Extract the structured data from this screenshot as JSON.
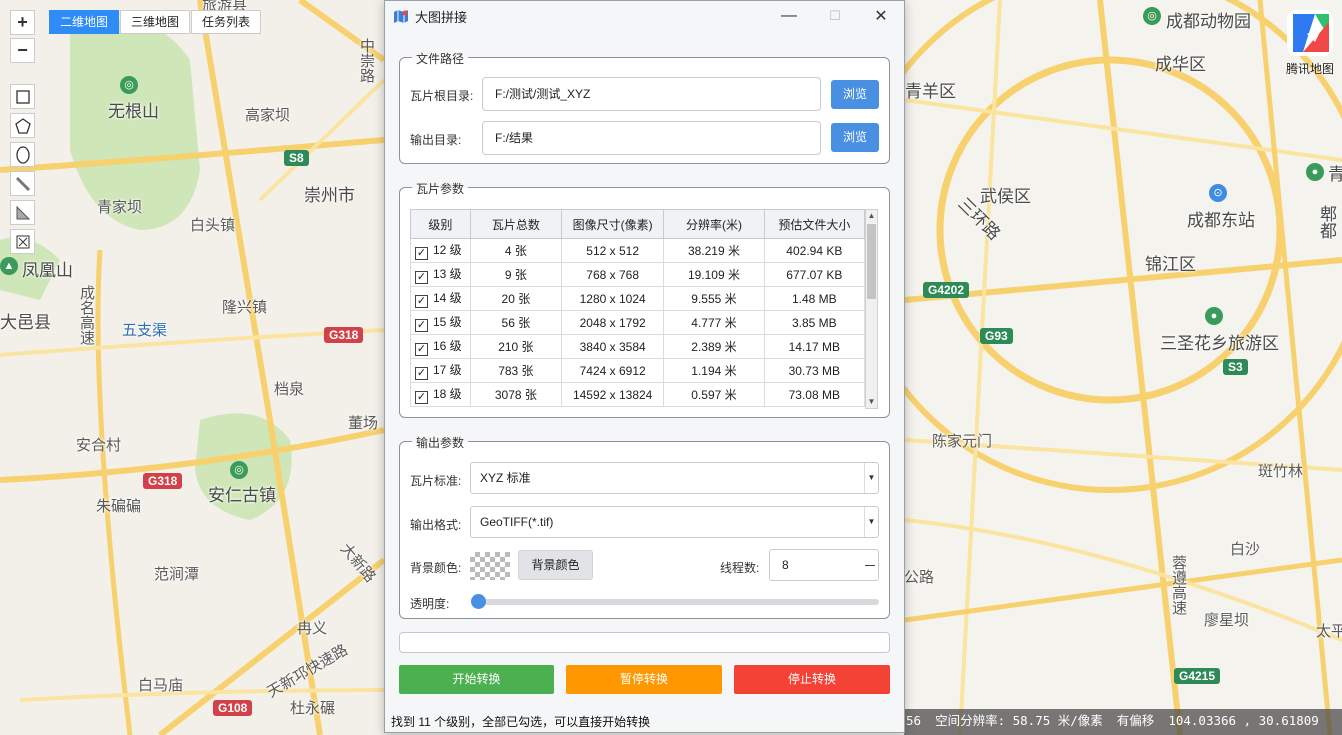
{
  "map": {
    "tabs": [
      {
        "label": "二维地图",
        "active": true
      },
      {
        "label": "三维地图",
        "active": false
      },
      {
        "label": "任务列表",
        "active": false
      }
    ],
    "zoom_in": "+",
    "zoom_out": "−",
    "brand": "腾讯地图",
    "labels": {
      "l1": "成都动物园",
      "l2": "成华区",
      "l3": "青羊区",
      "l4": "武侯区",
      "l5": "成都东站",
      "l6": "锦江区",
      "l7": "三圣花乡旅游区",
      "l8": "陈家元门",
      "l9": "斑竹林",
      "l10": "白沙",
      "l11": "廖星坝",
      "l12": "太平",
      "l13": "三环路",
      "l14": "蓉遵高速",
      "l15": "无根山",
      "l16": "高家坝",
      "l17": "崇州市",
      "l18": "青家坝",
      "l19": "白头镇",
      "l20": "凤凰山",
      "l21": "大邑县",
      "l22": "五支渠",
      "l23": "隆兴镇",
      "l24": "成名高速",
      "l25": "安合村",
      "l26": "安仁古镇",
      "l27": "朱碥碥",
      "l28": "范涧潭",
      "l29": "大新路",
      "l30": "冉义",
      "l31": "天新邛快速路",
      "l32": "白马庙",
      "l33": "杜永碾",
      "l34": "档泉",
      "l35": "董场",
      "l36": "旅游县",
      "l37": "公路",
      "l38": "郫都",
      "l39": "中崇路",
      "l40": "青"
    },
    "shields": {
      "s8": "S8",
      "g318a": "G318",
      "g318b": "G318",
      "g108": "G108",
      "g4202": "G4202",
      "g93": "G93",
      "s3": "S3",
      "g4215": "G4215"
    },
    "status": {
      "prefix": "56",
      "resolution": "空间分辨率: 58.75 米/像素",
      "offset": "有偏移",
      "coords": "104.03366 , 30.61809"
    }
  },
  "dialog": {
    "title": "大图拼接",
    "window_controls": {
      "minimize": "—",
      "maximize": "☐",
      "close": "✕"
    },
    "path_group": {
      "title": "文件路径",
      "tile_root_label": "瓦片根目录:",
      "tile_root_value": "F:/测试/测试_XYZ",
      "browse1": "浏览",
      "output_label": "输出目录:",
      "output_value": "F:/结果",
      "browse2": "浏览"
    },
    "tile_group": {
      "title": "瓦片参数",
      "headers": [
        "级别",
        "瓦片总数",
        "图像尺寸(像素)",
        "分辨率(米)",
        "预估文件大小"
      ],
      "rows": [
        {
          "level": "12 级",
          "count": "4 张",
          "size": "512 x 512",
          "res": "38.219 米",
          "est": "402.94 KB",
          "checked": true
        },
        {
          "level": "13 级",
          "count": "9 张",
          "size": "768 x 768",
          "res": "19.109 米",
          "est": "677.07 KB",
          "checked": true
        },
        {
          "level": "14 级",
          "count": "20 张",
          "size": "1280 x 1024",
          "res": "9.555 米",
          "est": "1.48 MB",
          "checked": true
        },
        {
          "level": "15 级",
          "count": "56 张",
          "size": "2048 x 1792",
          "res": "4.777 米",
          "est": "3.85 MB",
          "checked": true
        },
        {
          "level": "16 级",
          "count": "210 张",
          "size": "3840 x 3584",
          "res": "2.389 米",
          "est": "14.17 MB",
          "checked": true
        },
        {
          "level": "17 级",
          "count": "783 张",
          "size": "7424 x 6912",
          "res": "1.194 米",
          "est": "30.73 MB",
          "checked": true
        },
        {
          "level": "18 级",
          "count": "3078 张",
          "size": "14592 x 13824",
          "res": "0.597 米",
          "est": "73.08 MB",
          "checked": true
        }
      ]
    },
    "output_group": {
      "title": "输出参数",
      "standard_label": "瓦片标准:",
      "standard_value": "XYZ 标准",
      "format_label": "输出格式:",
      "format_value": "GeoTIFF(*.tif)",
      "bg_label": "背景颜色:",
      "bg_button": "背景颜色",
      "threads_label": "线程数:",
      "threads_value": "8",
      "opacity_label": "透明度:",
      "opacity_value": 0
    },
    "progress": 0,
    "actions": {
      "start": "开始转换",
      "pause": "暂停转换",
      "stop": "停止转换",
      "start_color": "#4caf50",
      "pause_color": "#ff9800",
      "stop_color": "#f44336"
    },
    "status_text": "找到 11 个级别，全部已勾选，可以直接开始转换"
  }
}
